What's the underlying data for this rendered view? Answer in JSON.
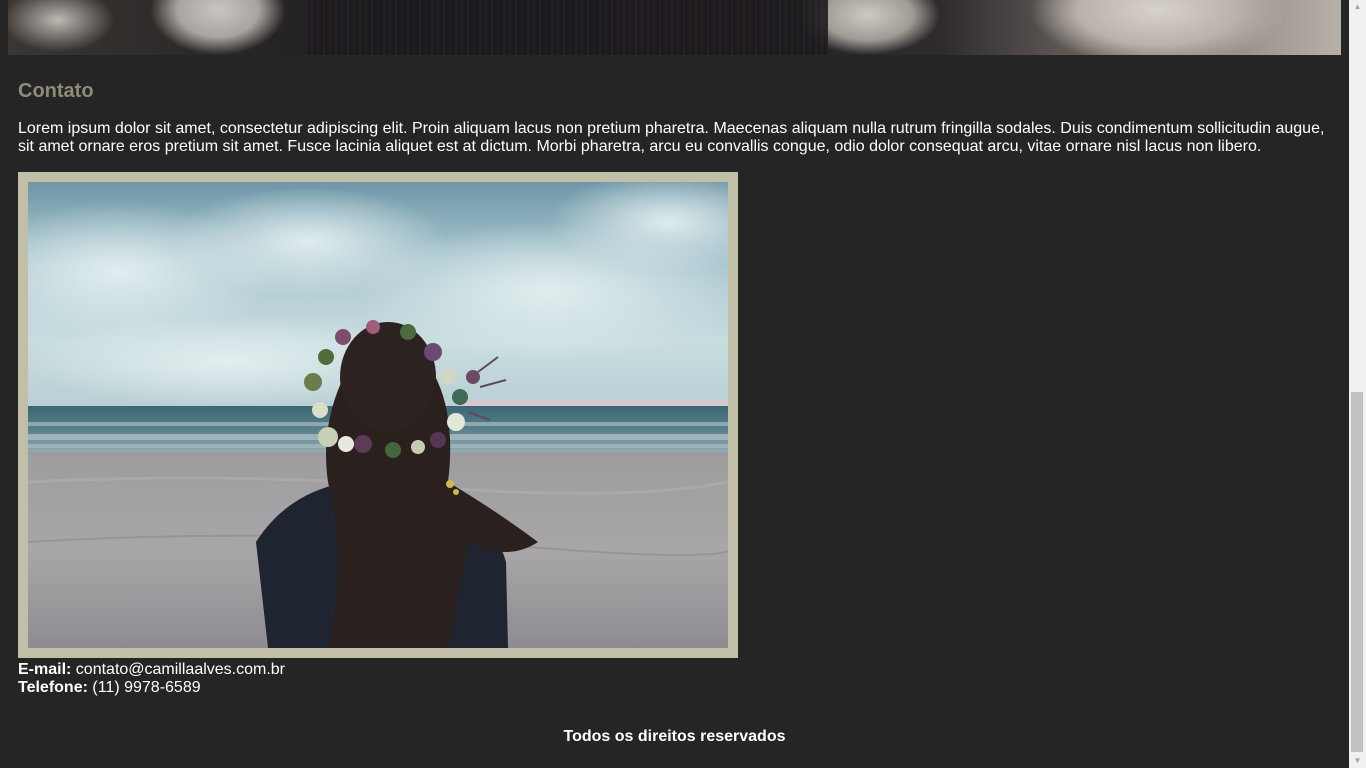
{
  "contact_section": {
    "title": "Contato",
    "intro": "Lorem ipsum dolor sit amet, consectetur adipiscing elit. Proin aliquam lacus non pretium pharetra. Maecenas aliquam nulla rutrum fringilla sodales. Duis condimentum sollicitudin augue, sit amet ornare eros pretium sit amet. Fusce lacinia aliquet est at dictum. Morbi pharetra, arcu eu convallis congue, odio dolor consequat arcu, vitae ornare nisl lacus non libero.",
    "email_label": "E-mail:",
    "email_value": "contato@camillaalves.com.br",
    "phone_label": "Telefone:",
    "phone_value": "(11) 9978-6589"
  },
  "footer": {
    "text": "Todos os direitos reservados"
  },
  "colors": {
    "background": "#262526",
    "title": "#8e8b76",
    "photo_border": "#c2bfa8",
    "text": "#ffffff"
  },
  "icons": {
    "scroll_up": "scroll-up-arrow-icon",
    "scroll_down": "scroll-down-arrow-icon"
  },
  "scrollbar": {
    "thumb_position": 0.51
  }
}
